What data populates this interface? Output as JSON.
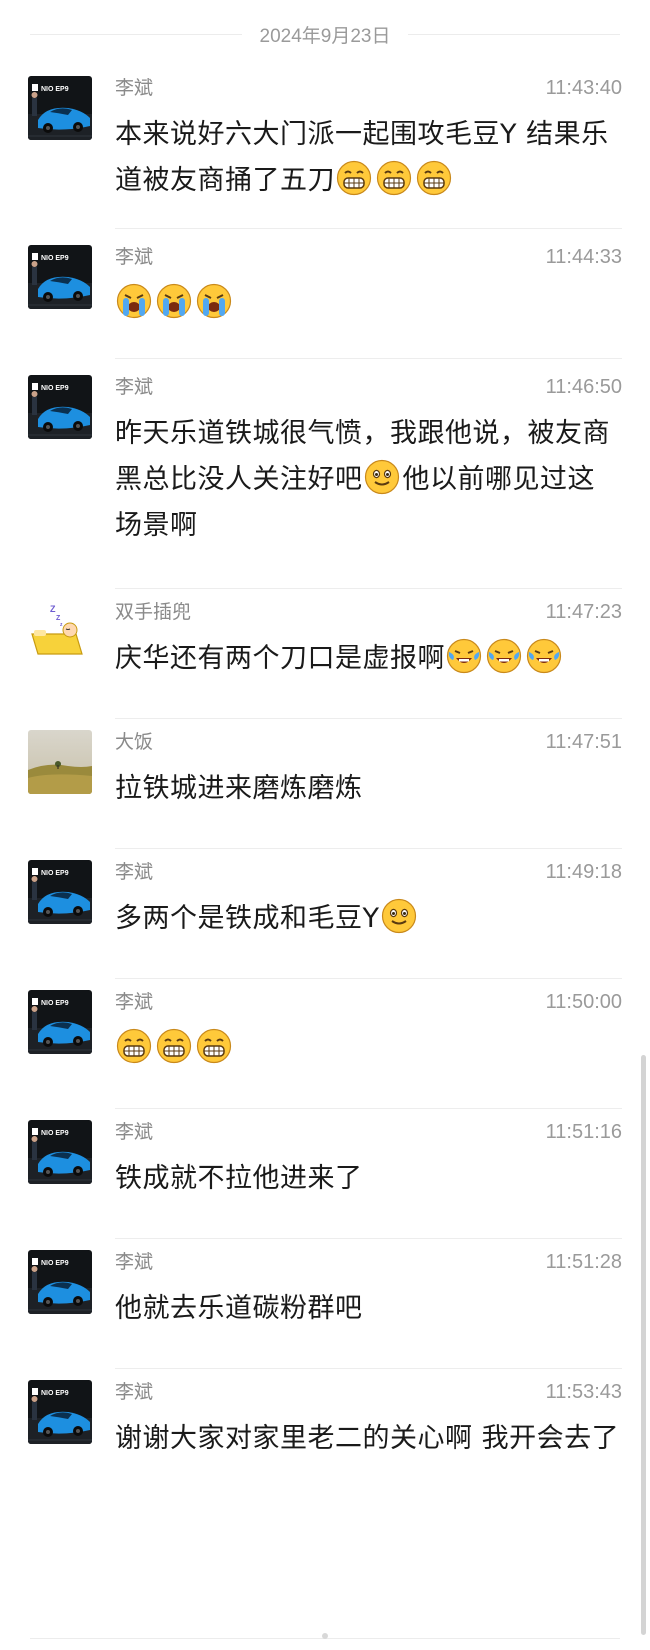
{
  "date_separator": "2024年9月23日",
  "messages": [
    {
      "sender": "李斌",
      "time": "11:43:40",
      "avatar": "car-avatar",
      "parts": [
        {
          "t": "本来说好六大门派一起围攻毛豆Y 结果乐道被友商捅了五刀"
        },
        {
          "e": "grin"
        },
        {
          "e": "grin"
        },
        {
          "e": "grin"
        }
      ]
    },
    {
      "sender": "李斌",
      "time": "11:44:33",
      "avatar": "car-avatar",
      "parts": [
        {
          "e": "cry"
        },
        {
          "e": "cry"
        },
        {
          "e": "cry"
        }
      ]
    },
    {
      "sender": "李斌",
      "time": "11:46:50",
      "avatar": "car-avatar",
      "parts": [
        {
          "t": "昨天乐道铁城很气愤，我跟他说，被友商黑总比没人关注好吧"
        },
        {
          "e": "smile"
        },
        {
          "t": "他以前哪见过这场景啊"
        }
      ]
    },
    {
      "sender": "双手插兜",
      "time": "11:47:23",
      "avatar": "sleep-avatar",
      "parts": [
        {
          "t": "庆华还有两个刀口是虚报啊"
        },
        {
          "e": "laughcry"
        },
        {
          "e": "laughcry"
        },
        {
          "e": "laughcry"
        }
      ]
    },
    {
      "sender": "大饭",
      "time": "11:47:51",
      "avatar": "landscape-avatar",
      "parts": [
        {
          "t": "拉铁城进来磨炼磨炼"
        }
      ]
    },
    {
      "sender": "李斌",
      "time": "11:49:18",
      "avatar": "car-avatar",
      "parts": [
        {
          "t": "多两个是铁成和毛豆Y"
        },
        {
          "e": "smile"
        }
      ]
    },
    {
      "sender": "李斌",
      "time": "11:50:00",
      "avatar": "car-avatar",
      "parts": [
        {
          "e": "grin"
        },
        {
          "e": "grin"
        },
        {
          "e": "grin"
        }
      ]
    },
    {
      "sender": "李斌",
      "time": "11:51:16",
      "avatar": "car-avatar",
      "parts": [
        {
          "t": "铁成就不拉他进来了"
        }
      ]
    },
    {
      "sender": "李斌",
      "time": "11:51:28",
      "avatar": "car-avatar",
      "parts": [
        {
          "t": "他就去乐道碳粉群吧"
        }
      ]
    },
    {
      "sender": "李斌",
      "time": "11:53:43",
      "avatar": "car-avatar",
      "parts": [
        {
          "t": "谢谢大家对家里老二的关心啊 我开会去了"
        }
      ]
    }
  ],
  "avatar_logo_text": "NIO EP9",
  "colors": {
    "sender": "#8a8a8a",
    "time": "#9a9a9a",
    "text": "#1a1a1a",
    "emoji_yellow": "#ffc93a",
    "emoji_tear": "#52a8f0"
  }
}
